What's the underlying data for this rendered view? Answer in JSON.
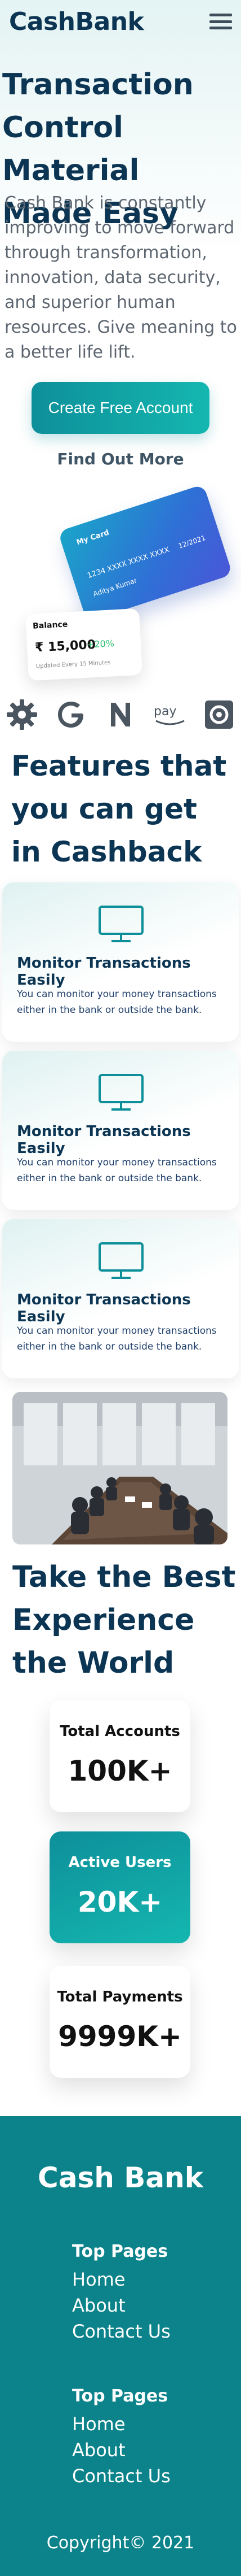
{
  "header": {
    "logo": "CashBank",
    "menu_icon": "hamburger-menu-icon"
  },
  "hero": {
    "title": "Transaction Control Material Made Easy",
    "description": "Cash Bank is constantly improving to move forward through transformation, innovation, data security, and superior human resources. Give meaning to a better life lift.",
    "primary_cta": "Create Free Account",
    "secondary_cta": "Find Out More"
  },
  "card_visual": {
    "card_name": "My Card",
    "card_number": "1234 XXXX XXXX XXXX",
    "card_expiry": "12/2021",
    "card_holder": "Aditya Kumar",
    "balance_label": "Balance",
    "balance_amount": "₹ 15,000",
    "balance_change": "+20%",
    "balance_updated": "Updated Every 15 Minutes"
  },
  "brands": [
    "gear-icon",
    "google-icon",
    "n-logo-icon",
    "pay-icon",
    "dashboard-icon"
  ],
  "features": {
    "title": "Features that you can get in Cashback",
    "items": [
      {
        "title": "Monitor Transactions Easily",
        "description": "You can monitor your money transactions either in the bank or outside the bank."
      },
      {
        "title": "Monitor Transactions Easily",
        "description": "You can monitor your money transactions either in the bank or outside the bank."
      },
      {
        "title": "Monitor Transactions Easily",
        "description": "You can monitor your money transactions either in the bank or outside the bank."
      }
    ]
  },
  "experience": {
    "title": "Take the Best Experience the World",
    "stats": [
      {
        "label": "Total Accounts",
        "value": "100K+"
      },
      {
        "label": "Active Users",
        "value": "20K+"
      },
      {
        "label": "Total Payments",
        "value": "9999K+"
      }
    ]
  },
  "footer": {
    "brand": "Cash Bank",
    "columns": [
      {
        "heading": "Top Pages",
        "links": [
          "Home",
          "About",
          "Contact Us"
        ]
      },
      {
        "heading": "Top Pages",
        "links": [
          "Home",
          "About",
          "Contact Us"
        ]
      }
    ],
    "copyright": "Copyright©  2021"
  },
  "colors": {
    "primary": "#0b3553",
    "accent": "#0d8f9a",
    "footer_bg": "#0c838b"
  }
}
